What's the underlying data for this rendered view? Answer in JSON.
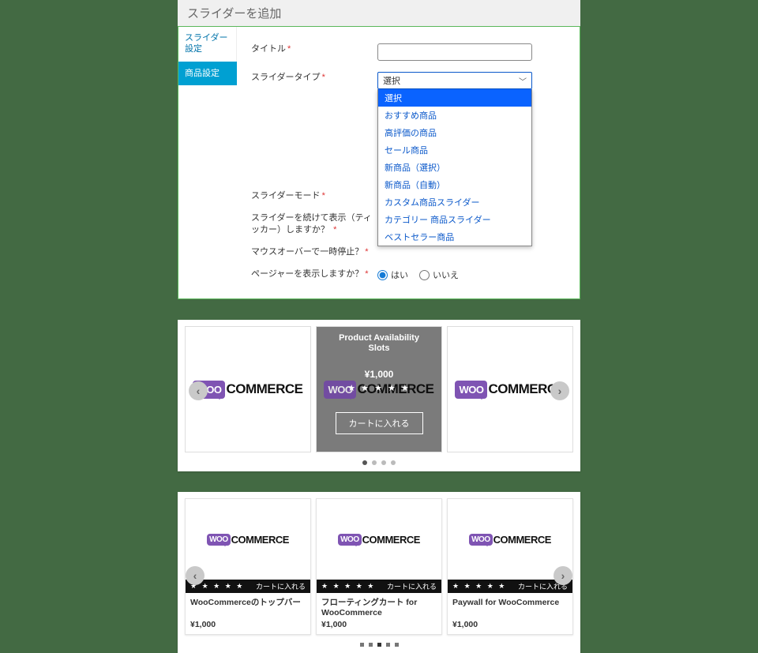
{
  "panel1": {
    "heading": "スライダーを追加",
    "tabs": [
      {
        "label": "スライダー設定"
      },
      {
        "label": "商品設定"
      }
    ],
    "fields": {
      "title_label": "タイトル",
      "slider_type_label": "スライダータイプ",
      "slider_type_selected": "選択",
      "slider_type_options": [
        "選択",
        "おすすめ商品",
        "高評価の商品",
        "セール商品",
        "新商品（選択）",
        "新商品（自動）",
        "カスタム商品スライダー",
        "カテゴリー 商品スライダー",
        "ベストセラー商品"
      ],
      "slider_mode_label": "スライダーモード",
      "ticker_label": "スライダーを続けて表示（ティッカー）しますか？",
      "hover_pause_label": "マウスオーバーで一時停止？",
      "pager_label": "ページャーを表示しますか？",
      "radio_yes": "はい",
      "radio_no": "いいえ"
    }
  },
  "logo": {
    "bubble": "WOO",
    "text": "COMMERCE"
  },
  "panel2": {
    "overlay": {
      "title_l1": "Product Availability",
      "title_l2": "Slots",
      "price": "¥1,000",
      "stars": "★ ★ ★ ★ ★",
      "add_to_cart": "カートに入れる"
    },
    "dots": 4,
    "active_dot": 0
  },
  "panel3": {
    "stars": "★ ★ ★ ★ ★",
    "cart_label": "カートに入れる",
    "items": [
      {
        "name": "WooCommerceのトップバー",
        "price": "¥1,000"
      },
      {
        "name": "フローティングカート for WooCommerce",
        "price": "¥1,000"
      },
      {
        "name": "Paywall for WooCommerce",
        "price": "¥1,000"
      }
    ],
    "dots": 5,
    "active_dot": 2
  }
}
